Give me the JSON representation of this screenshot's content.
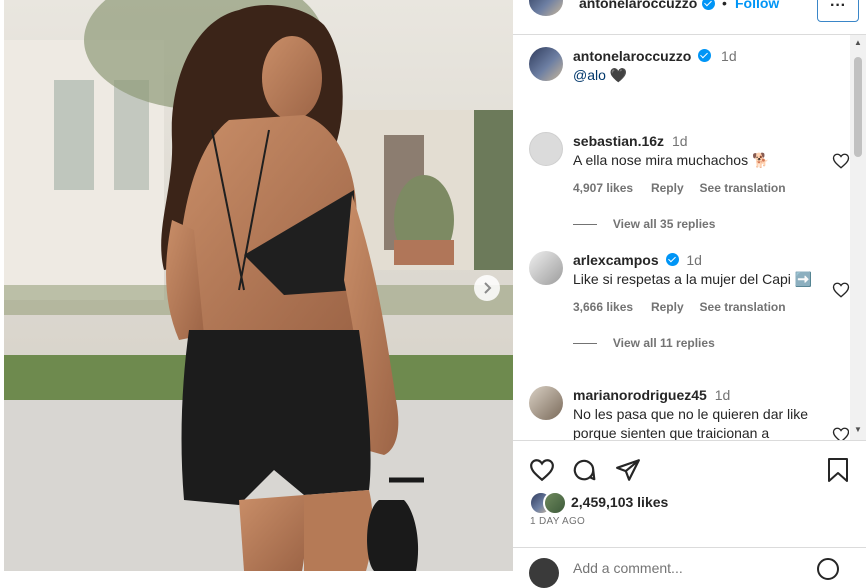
{
  "post": {
    "author": "antonelaroccuzzo",
    "follow_label": "Follow",
    "dot": "•",
    "more_label": "···",
    "caption_time": "1d",
    "caption_text": "@alo 🖤"
  },
  "comments": [
    {
      "user": "sebastian.16z",
      "time": "1d",
      "verified": false,
      "text": "A ella nose mira muchachos 🐕",
      "likes": "4,907 likes",
      "reply": "Reply",
      "translate": "See translation",
      "view_replies": "View all 35 replies"
    },
    {
      "user": "arlexcampos",
      "time": "1d",
      "verified": true,
      "text": "Like si respetas a la mujer del Capi ➡️",
      "likes": "3,666 likes",
      "reply": "Reply",
      "translate": "See translation",
      "view_replies": "View all 11 replies"
    },
    {
      "user": "marianorodriguez45",
      "time": "1d",
      "verified": false,
      "text": "No les pasa que no le quieren dar like porque sienten que traicionan a"
    }
  ],
  "footer": {
    "likes": "2,459,103 likes",
    "date": "1 DAY AGO",
    "add_comment_placeholder": "Add a comment..."
  },
  "colors": {
    "accent": "#0095f6",
    "border": "#dbdbdb",
    "muted": "#737373"
  },
  "icons": [
    "heart-icon",
    "comment-icon",
    "share-icon",
    "save-icon",
    "next-arrow-icon",
    "emoji-icon"
  ]
}
